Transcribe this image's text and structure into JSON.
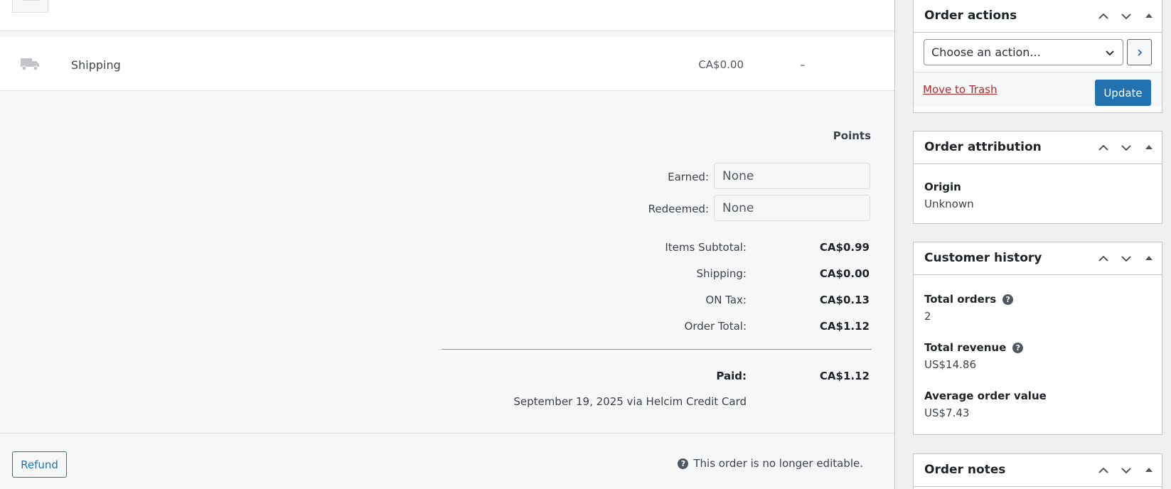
{
  "order_items": {
    "shipping_row": {
      "label": "Shipping",
      "cost": "CA$0.00",
      "tax": "–"
    }
  },
  "points": {
    "heading": "Points",
    "earned_label": "Earned:",
    "earned_placeholder": "None",
    "redeemed_label": "Redeemed:",
    "redeemed_placeholder": "None"
  },
  "totals": {
    "items_subtotal_label": "Items Subtotal:",
    "items_subtotal_value": "CA$0.99",
    "shipping_label": "Shipping:",
    "shipping_value": "CA$0.00",
    "tax_label": "ON Tax:",
    "tax_value": "CA$0.13",
    "order_total_label": "Order Total:",
    "order_total_value": "CA$1.12",
    "paid_label": "Paid:",
    "paid_value": "CA$1.12",
    "paid_note": "September 19, 2025 via Helcim Credit Card"
  },
  "footer": {
    "refund_label": "Refund",
    "not_editable_text": "This order is no longer editable."
  },
  "order_actions": {
    "title": "Order actions",
    "select_value": "Choose an action...",
    "trash_label": "Move to Trash",
    "update_label": "Update"
  },
  "order_attribution": {
    "title": "Order attribution",
    "origin_label": "Origin",
    "origin_value": "Unknown"
  },
  "customer_history": {
    "title": "Customer history",
    "total_orders_label": "Total orders",
    "total_orders_value": "2",
    "total_revenue_label": "Total revenue",
    "total_revenue_value": "US$14.86",
    "avg_order_label": "Average order value",
    "avg_order_value": "US$7.43"
  },
  "order_notes": {
    "title": "Order notes"
  },
  "colors": {
    "primary": "#2271b1",
    "danger": "#b32d2e"
  }
}
